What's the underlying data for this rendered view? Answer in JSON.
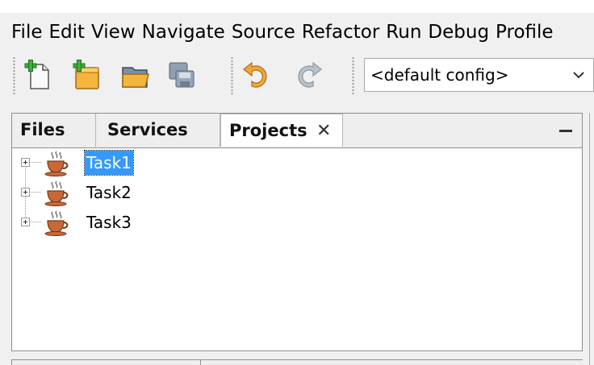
{
  "menu": [
    "File",
    "Edit",
    "View",
    "Navigate",
    "Source",
    "Refactor",
    "Run",
    "Debug",
    "Profile"
  ],
  "toolbar": {
    "icons": [
      "new-file-icon",
      "new-project-icon",
      "open-project-icon",
      "save-all-icon",
      "undo-icon",
      "redo-icon"
    ],
    "config_value": "<default config>"
  },
  "panel": {
    "tabs": [
      {
        "label": "Files"
      },
      {
        "label": "Services"
      },
      {
        "label": "Projects",
        "close": "✕"
      }
    ],
    "tree": [
      {
        "label": "Task1",
        "selected": true
      },
      {
        "label": "Task2",
        "selected": false
      },
      {
        "label": "Task3",
        "selected": false
      }
    ]
  },
  "colors": {
    "selection": "#3399ff",
    "accent_cup": "#c8683a"
  }
}
